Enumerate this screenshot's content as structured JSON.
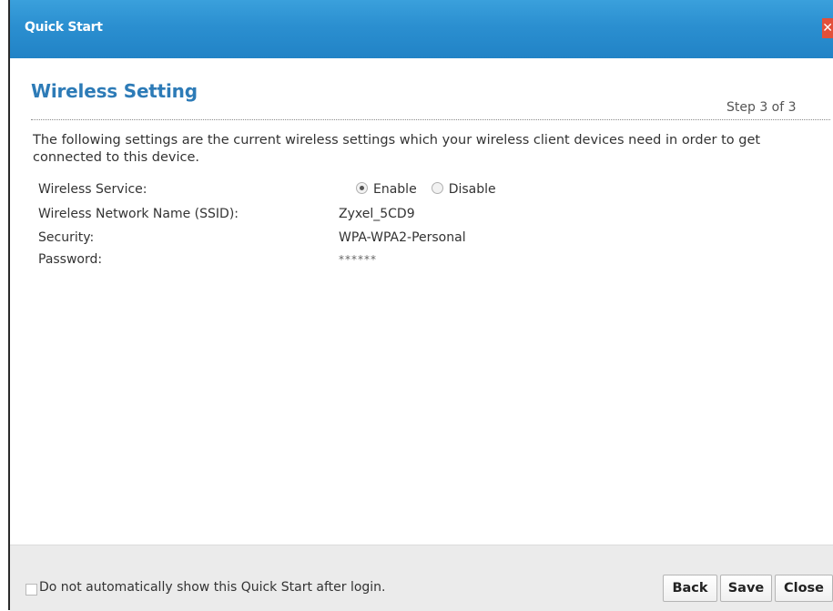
{
  "window": {
    "title": "Quick Start",
    "close_label": "✕"
  },
  "section": {
    "heading": "Wireless Setting",
    "step": "Step 3 of 3"
  },
  "description": "The following settings are the current wireless settings which your wireless client devices need in order to get connected to this device.",
  "fields": {
    "wireless_service": {
      "label": "Wireless Service:",
      "options": [
        "Enable",
        "Disable"
      ],
      "selected": "Enable"
    },
    "ssid": {
      "label": "Wireless Network Name (SSID):",
      "value": "Zyxel_5CD9"
    },
    "security": {
      "label": "Security:",
      "value": "WPA-WPA2-Personal"
    },
    "password": {
      "label": "Password:",
      "value": "******"
    }
  },
  "footer": {
    "checkbox_label": "Do not automatically show this Quick Start after login.",
    "buttons": {
      "back": "Back",
      "save": "Save",
      "close": "Close"
    }
  }
}
